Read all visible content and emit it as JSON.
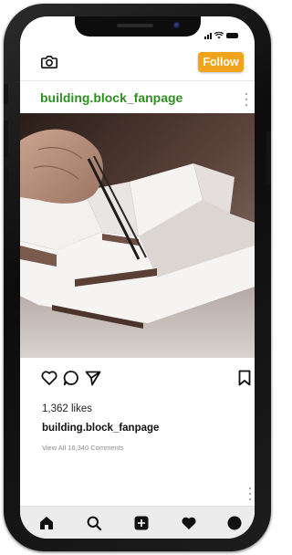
{
  "header": {
    "camera_icon": "camera-icon",
    "follow_label": "Follow",
    "follow_color": "#f0a31b"
  },
  "post": {
    "username": "building.block_fanpage",
    "username_color": "#2f8f22",
    "menu_icon": "more-vertical-icon",
    "likes": "1,362 likes",
    "caption_user": "building.block_fanpage",
    "comments_link": "View All 16,340 Comments",
    "actions": [
      "heart-icon",
      "comment-icon",
      "send-icon",
      "bookmark-icon"
    ]
  },
  "bottom_nav": {
    "items": [
      "home-icon",
      "search-icon",
      "add-post-icon",
      "activity-heart-icon",
      "profile-icon"
    ]
  }
}
